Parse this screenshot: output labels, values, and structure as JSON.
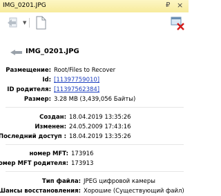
{
  "window": {
    "title": "IMG_0201.JPG",
    "pin_glyph": "₽",
    "close_glyph": "×"
  },
  "file": {
    "name": "IMG_0201.JPG"
  },
  "location": [
    {
      "label": "Размещение:",
      "value": "Root/Files to Recover",
      "link": false
    },
    {
      "label": "Id:",
      "value": "[11397759010]",
      "link": true
    },
    {
      "label": "ID родителя:",
      "value": "[11397562384]",
      "link": true
    },
    {
      "label": "Размер:",
      "value": "3.28 MB (3,439,056 Байты)",
      "link": false
    }
  ],
  "dates": [
    {
      "label": "Создан:",
      "value": "18.04.2019 13:35:26"
    },
    {
      "label": "Изменен:",
      "value": "24.05.2009 17:43:16"
    },
    {
      "label": "Последний доступ :",
      "value": "18.04.2019 13:35:26"
    }
  ],
  "mft": [
    {
      "label": "номер MFT:",
      "value": "173916"
    },
    {
      "label": "Номер MFT родителя:",
      "value": "173913"
    }
  ],
  "misc": [
    {
      "label": "Тип файла:",
      "value": "JPEG цифровой камеры"
    },
    {
      "label": "Шансы восстановления:",
      "value": "Хорошие (Существующий файл)"
    }
  ]
}
